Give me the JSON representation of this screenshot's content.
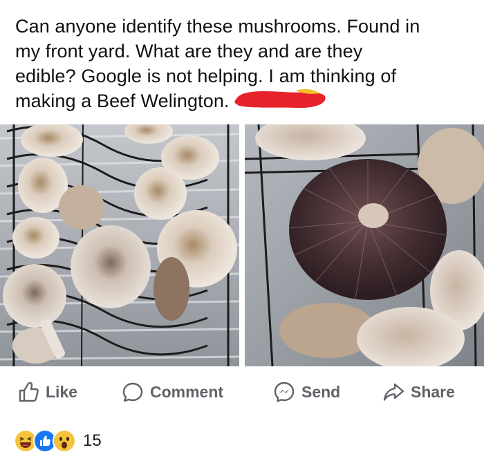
{
  "post": {
    "text_lines": [
      "Can anyone identify these mushrooms. Found in",
      "my front yard. What are they and are they",
      "edible? Google is not helping. I am thinking of",
      "making a Beef Welington."
    ]
  },
  "actions": {
    "like": "Like",
    "comment": "Comment",
    "send": "Send",
    "share": "Share"
  },
  "reactions": {
    "count": "15",
    "types": [
      "haha",
      "like",
      "wow"
    ]
  },
  "colors": {
    "action_gray": "#5f6368",
    "like_blue": "#1877f2",
    "haha_yellow": "#f7c23c",
    "redaction_red": "#e8222a"
  }
}
